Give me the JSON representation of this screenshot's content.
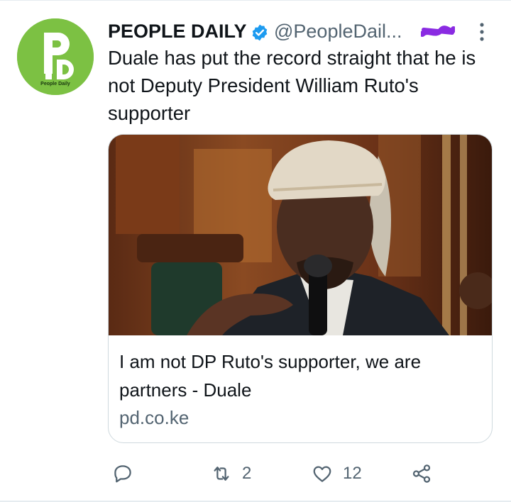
{
  "tweet": {
    "author_name": "PEOPLE DAILY",
    "author_handle": "@PeopleDail...",
    "avatar": {
      "logo_letters": "PD",
      "logo_caption": "People Daily",
      "color": "#7cc143"
    },
    "verified": true,
    "text": "Duale has put the record straight that he is not Deputy President William Ruto's supporter",
    "card": {
      "title": "I am not DP Ruto's supporter, we are partners - Duale",
      "domain": "pd.co.ke"
    },
    "actions": {
      "reply": {
        "icon": "reply-icon",
        "count": ""
      },
      "retweet": {
        "icon": "retweet-icon",
        "count": "2"
      },
      "like": {
        "icon": "heart-icon",
        "count": "12"
      },
      "share": {
        "icon": "share-icon"
      }
    }
  },
  "colors": {
    "verified_blue": "#1d9bf0",
    "secondary_text": "#536471",
    "brand_green": "#7cc143",
    "redaction_purple": "#8a2be2"
  }
}
